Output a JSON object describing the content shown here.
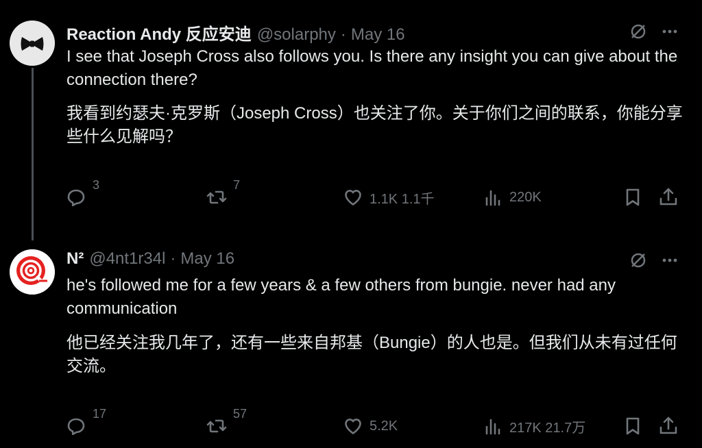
{
  "tweets": [
    {
      "name": "Reaction Andy 反应安迪",
      "handle": "@solarphy",
      "separator": "·",
      "date": "May 16",
      "text_en": "I see that Joseph Cross also follows you. Is there any insight you can give about the connection there?",
      "text_zh": "我看到约瑟夫·克罗斯（Joseph Cross）也关注了你。关于你们之间的联系，你能分享些什么见解吗？",
      "stats": {
        "replies": "3",
        "reposts": "7",
        "likes": "1.1K 1.1千",
        "views": "220K"
      },
      "avatar_icon": "bowtie-avatar-icon"
    },
    {
      "name": "N²",
      "handle": "@4nt1r34l",
      "separator": "·",
      "date": "May 16",
      "text_en": "he's followed me for a few years & a few others from bungie. never had any communication",
      "text_zh": "他已经关注我几年了，还有一些来自邦基（Bungie）的人也是。但我们从未有过任何交流。",
      "stats": {
        "replies": "17",
        "reposts": "57",
        "likes": "5.2K",
        "views": "217K 21.7万"
      },
      "avatar_icon": "red-target-avatar-icon"
    }
  ],
  "colors": {
    "background": "#000000",
    "text": "#e7e9ea",
    "muted": "#71767b",
    "thread_line": "#4a4f54",
    "accent_red": "#e52220"
  },
  "icons": {
    "grok": "grok-icon",
    "more": "more-icon",
    "reply": "reply-icon",
    "repost": "repost-icon",
    "like": "like-icon",
    "views": "views-icon",
    "bookmark": "bookmark-icon",
    "share": "share-icon"
  }
}
